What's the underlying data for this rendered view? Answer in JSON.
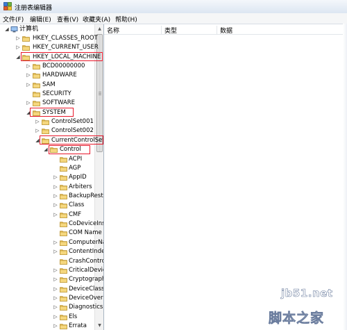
{
  "window": {
    "title": "注册表编辑器"
  },
  "menu": [
    {
      "label": "文件(F)"
    },
    {
      "label": "编辑(E)"
    },
    {
      "label": "查看(V)"
    },
    {
      "label": "收藏夹(A)"
    },
    {
      "label": "帮助(H)"
    }
  ],
  "columns": [
    {
      "label": "名称"
    },
    {
      "label": "类型"
    },
    {
      "label": "数据"
    }
  ],
  "tree": {
    "root": {
      "label": "计算机",
      "expander": "◢"
    },
    "top": [
      {
        "label": "HKEY_CLASSES_ROOT",
        "expander": "▷"
      },
      {
        "label": "HKEY_CURRENT_USER",
        "expander": "▷"
      },
      {
        "label": "HKEY_LOCAL_MACHINE",
        "expander": "◢"
      }
    ],
    "hklm_children": [
      {
        "label": "BCD00000000",
        "expander": "▷"
      },
      {
        "label": "HARDWARE",
        "expander": "▷"
      },
      {
        "label": "SAM",
        "expander": "▷"
      },
      {
        "label": "SECURITY",
        "expander": ""
      },
      {
        "label": "SOFTWARE",
        "expander": "▷"
      },
      {
        "label": "SYSTEM",
        "expander": "◢"
      }
    ],
    "system_children": [
      {
        "label": "ControlSet001",
        "expander": "▷"
      },
      {
        "label": "ControlSet002",
        "expander": "▷"
      },
      {
        "label": "CurrentControlSet",
        "expander": "◢"
      }
    ],
    "ccs_children": [
      {
        "label": "Control",
        "expander": "◢"
      }
    ],
    "control_children": [
      {
        "label": "ACPI",
        "expander": ""
      },
      {
        "label": "AGP",
        "expander": ""
      },
      {
        "label": "AppID",
        "expander": "▷"
      },
      {
        "label": "Arbiters",
        "expander": "▷"
      },
      {
        "label": "BackupRestore",
        "expander": "▷"
      },
      {
        "label": "Class",
        "expander": "▷"
      },
      {
        "label": "CMF",
        "expander": "▷"
      },
      {
        "label": "CoDeviceInstallers",
        "expander": ""
      },
      {
        "label": "COM Name Arbiter",
        "expander": ""
      },
      {
        "label": "ComputerName",
        "expander": "▷"
      },
      {
        "label": "ContentIndex",
        "expander": "▷"
      },
      {
        "label": "CrashControl",
        "expander": ""
      },
      {
        "label": "CriticalDeviceDatabase",
        "expander": "▷"
      },
      {
        "label": "Cryptography",
        "expander": "▷"
      },
      {
        "label": "DeviceClasses",
        "expander": "▷"
      },
      {
        "label": "DeviceOverrides",
        "expander": "▷"
      },
      {
        "label": "Diagnostics",
        "expander": "▷"
      },
      {
        "label": "Els",
        "expander": "▷"
      },
      {
        "label": "Errata",
        "expander": "▷"
      }
    ]
  },
  "watermark": {
    "domain": "jb51.net",
    "name": "脚本之家"
  },
  "colors": {
    "highlight_box": "#e8172a",
    "folder": "#e8c15a"
  }
}
